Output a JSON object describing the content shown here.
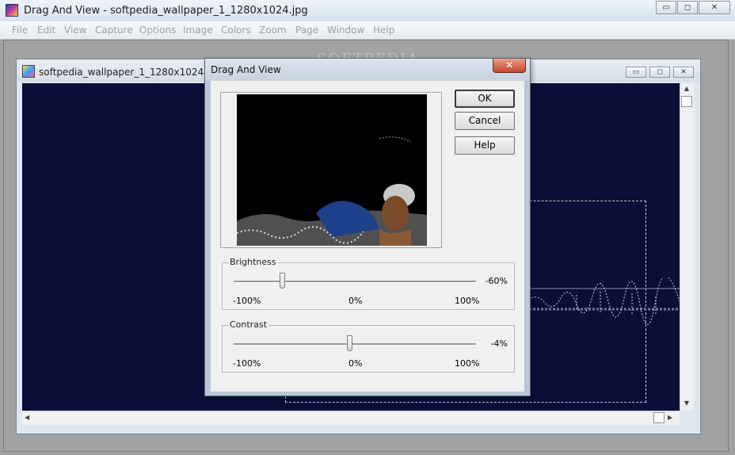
{
  "app": {
    "title": "Drag And View - softpedia_wallpaper_1_1280x1024.jpg",
    "controls": {
      "minimize": "▭",
      "maximize": "◻",
      "close": "✕"
    }
  },
  "menubar": {
    "items": [
      "File",
      "Edit",
      "View",
      "Capture",
      "Options",
      "Image",
      "Colors",
      "Zoom",
      "Page",
      "Window",
      "Help"
    ]
  },
  "watermark": "SOFTPEDIA",
  "child": {
    "title": "softpedia_wallpaper_1_1280x1024.jpg",
    "controls": {
      "minimize": "▭",
      "maximize": "◻",
      "close": "✕"
    }
  },
  "dialog": {
    "title": "Drag And View",
    "close_glyph": "✕",
    "buttons": {
      "ok": "OK",
      "cancel": "Cancel",
      "help": "Help"
    },
    "brightness": {
      "label": "Brightness",
      "value_text": "-60%",
      "value": -60,
      "min": "-100%",
      "mid": "0%",
      "max": "100%"
    },
    "contrast": {
      "label": "Contrast",
      "value_text": "-4%",
      "value": -4,
      "min": "-100%",
      "mid": "0%",
      "max": "100%"
    }
  },
  "colors": {
    "canvas": "#0a0f3a",
    "dialog_frame": "#b8c6d6",
    "close_red": "#c8452b"
  }
}
